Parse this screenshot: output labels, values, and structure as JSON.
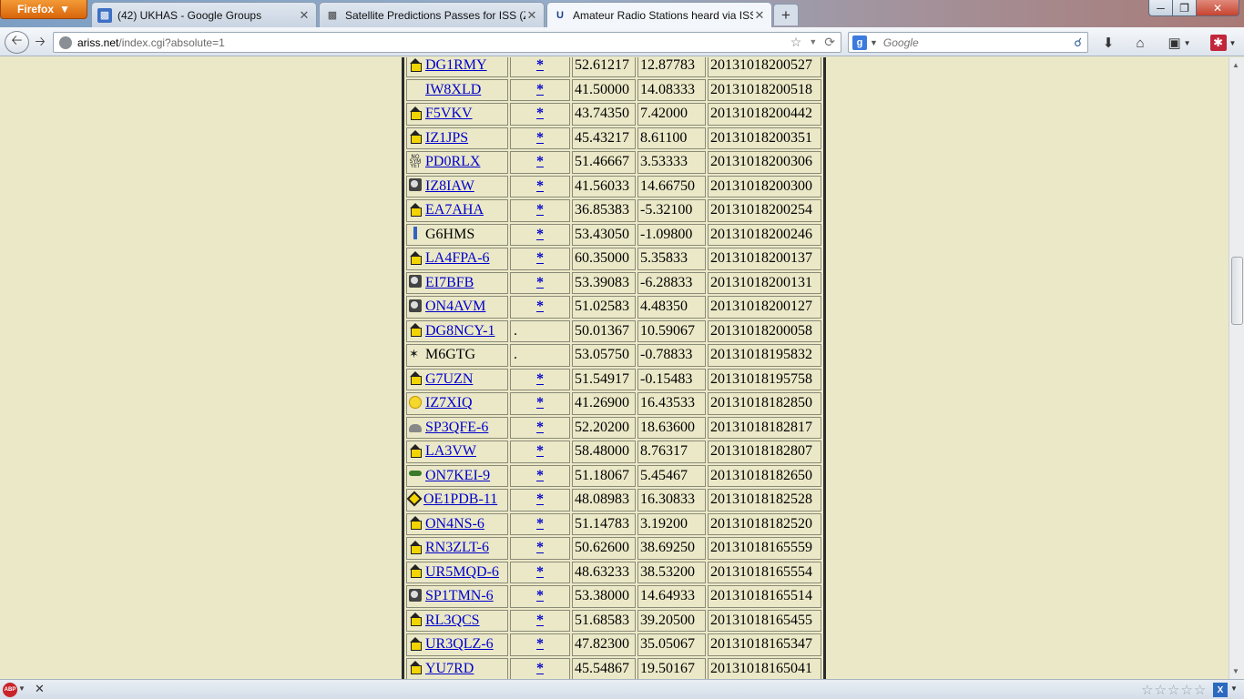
{
  "browser": {
    "menu_label": "Firefox",
    "tabs": [
      {
        "title": "(42) UKHAS - Google Groups",
        "favicon": "google-groups-icon",
        "active": false
      },
      {
        "title": "Satellite Predictions Passes for ISS (ZA...",
        "favicon": "satellite-icon",
        "active": false
      },
      {
        "title": "Amateur Radio Stations heard via ISS",
        "favicon": "ariss-icon",
        "active": true
      }
    ],
    "url_host": "ariss.net",
    "url_path": "/index.cgi?absolute=1",
    "search_engine": "Google",
    "search_placeholder": "Google"
  },
  "stations": [
    {
      "symbol": "house",
      "call": "DG1RMY",
      "linked": true,
      "marker": "*",
      "lat": "52.61217",
      "lon": "12.87783",
      "time": "20131018200527"
    },
    {
      "symbol": "blank",
      "call": "IW8XLD",
      "linked": true,
      "marker": "*",
      "lat": "41.50000",
      "lon": "14.08333",
      "time": "20131018200518"
    },
    {
      "symbol": "house",
      "call": "F5VKV",
      "linked": true,
      "marker": "*",
      "lat": "43.74350",
      "lon": "7.42000",
      "time": "20131018200442"
    },
    {
      "symbol": "house",
      "call": "IZ1JPS",
      "linked": true,
      "marker": "*",
      "lat": "45.43217",
      "lon": "8.61100",
      "time": "20131018200351"
    },
    {
      "symbol": "nosym",
      "call": "PD0RLX",
      "linked": true,
      "marker": "*",
      "lat": "51.46667",
      "lon": "3.53333",
      "time": "20131018200306"
    },
    {
      "symbol": "dish",
      "call": "IZ8IAW",
      "linked": true,
      "marker": "*",
      "lat": "41.56033",
      "lon": "14.66750",
      "time": "20131018200300"
    },
    {
      "symbol": "house",
      "call": "EA7AHA",
      "linked": true,
      "marker": "*",
      "lat": "36.85383",
      "lon": "-5.32100",
      "time": "20131018200254"
    },
    {
      "symbol": "tower",
      "call": "G6HMS",
      "linked": false,
      "marker": "*",
      "lat": "53.43050",
      "lon": "-1.09800",
      "time": "20131018200246"
    },
    {
      "symbol": "house",
      "call": "LA4FPA-6",
      "linked": true,
      "marker": "*",
      "lat": "60.35000",
      "lon": "5.35833",
      "time": "20131018200137"
    },
    {
      "symbol": "dish",
      "call": "EI7BFB",
      "linked": true,
      "marker": "*",
      "lat": "53.39083",
      "lon": "-6.28833",
      "time": "20131018200131"
    },
    {
      "symbol": "dish",
      "call": "ON4AVM",
      "linked": true,
      "marker": "*",
      "lat": "51.02583",
      "lon": "4.48350",
      "time": "20131018200127"
    },
    {
      "symbol": "house",
      "call": "DG8NCY-1",
      "linked": true,
      "marker": ".",
      "lat": "50.01367",
      "lon": "10.59067",
      "time": "20131018200058"
    },
    {
      "symbol": "star",
      "call": "M6GTG",
      "linked": false,
      "marker": ".",
      "lat": "53.05750",
      "lon": "-0.78833",
      "time": "20131018195832"
    },
    {
      "symbol": "house",
      "call": "G7UZN",
      "linked": true,
      "marker": "*",
      "lat": "51.54917",
      "lon": "-0.15483",
      "time": "20131018195758"
    },
    {
      "symbol": "sun",
      "call": "IZ7XIQ",
      "linked": true,
      "marker": "*",
      "lat": "41.26900",
      "lon": "16.43533",
      "time": "20131018182850"
    },
    {
      "symbol": "car",
      "call": "SP3QFE-6",
      "linked": true,
      "marker": "*",
      "lat": "52.20200",
      "lon": "18.63600",
      "time": "20131018182817"
    },
    {
      "symbol": "house",
      "call": "LA3VW",
      "linked": true,
      "marker": "*",
      "lat": "58.48000",
      "lon": "8.76317",
      "time": "20131018182807"
    },
    {
      "symbol": "bike",
      "call": "ON7KEI-9",
      "linked": true,
      "marker": "*",
      "lat": "51.18067",
      "lon": "5.45467",
      "time": "20131018182650"
    },
    {
      "symbol": "diamond",
      "call": "OE1PDB-11",
      "linked": true,
      "marker": "*",
      "lat": "48.08983",
      "lon": "16.30833",
      "time": "20131018182528"
    },
    {
      "symbol": "house",
      "call": "ON4NS-6",
      "linked": true,
      "marker": "*",
      "lat": "51.14783",
      "lon": "3.19200",
      "time": "20131018182520"
    },
    {
      "symbol": "house",
      "call": "RN3ZLT-6",
      "linked": true,
      "marker": "*",
      "lat": "50.62600",
      "lon": "38.69250",
      "time": "20131018165559"
    },
    {
      "symbol": "house",
      "call": "UR5MQD-6",
      "linked": true,
      "marker": "*",
      "lat": "48.63233",
      "lon": "38.53200",
      "time": "20131018165554"
    },
    {
      "symbol": "dish",
      "call": "SP1TMN-6",
      "linked": true,
      "marker": "*",
      "lat": "53.38000",
      "lon": "14.64933",
      "time": "20131018165514"
    },
    {
      "symbol": "house",
      "call": "RL3QCS",
      "linked": true,
      "marker": "*",
      "lat": "51.68583",
      "lon": "39.20500",
      "time": "20131018165455"
    },
    {
      "symbol": "house",
      "call": "UR3QLZ-6",
      "linked": true,
      "marker": "*",
      "lat": "47.82300",
      "lon": "35.05067",
      "time": "20131018165347"
    },
    {
      "symbol": "house",
      "call": "YU7RD",
      "linked": true,
      "marker": "*",
      "lat": "45.54867",
      "lon": "19.50167",
      "time": "20131018165041"
    }
  ],
  "colors": {
    "page_background": "#eae8c7",
    "link": "#0000cc",
    "firefox_button": "#e3740f"
  },
  "addon_bar": {
    "adblock_label": "ABP",
    "xmarks_label": "X"
  }
}
